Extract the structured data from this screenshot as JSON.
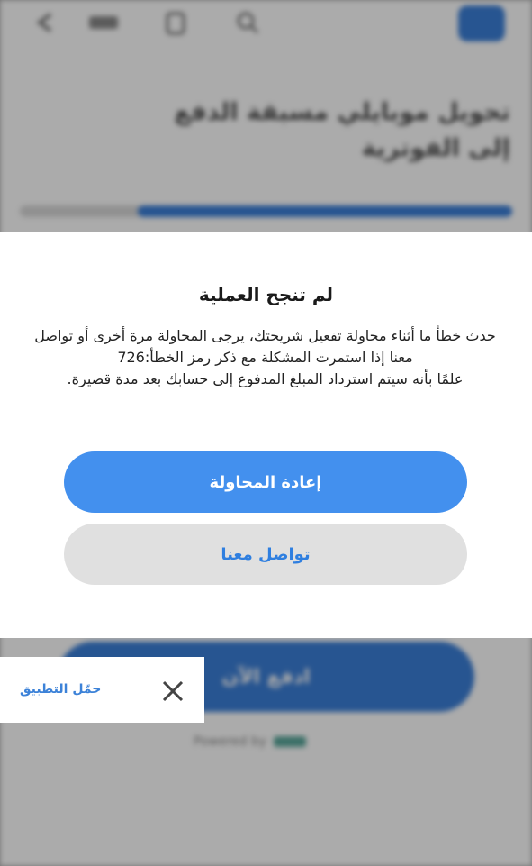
{
  "background": {
    "heading_line1": "تحويل موبايلي مسبقة الدفع",
    "heading_line2": "إلى الفوترية",
    "pay_button_label": "ادفع الآن",
    "powered_by": "Powered by",
    "progress_fraction": 0.76
  },
  "dialog": {
    "title": "لم تنجح العملية",
    "message_line1": "حدث خطأ ما أثناء محاولة تفعيل شريحتك، يرجى المحاولة مرة أخرى أو تواصل",
    "message_line2": "معنا إذا استمرت المشكلة مع ذكر رمز الخطأ:726",
    "message_line3": "علمًا بأنه سيتم استرداد المبلغ المدفوع إلى حسابك بعد مدة قصيرة.",
    "retry_label": "إعادة المحاولة",
    "contact_label": "تواصل معنا"
  },
  "banner": {
    "download_label": "حمّل التطبيق",
    "close_icon": "close-icon"
  },
  "colors": {
    "primary": "#4390ee",
    "secondary_bg": "#e0e0e0",
    "link": "#3c82d8"
  }
}
